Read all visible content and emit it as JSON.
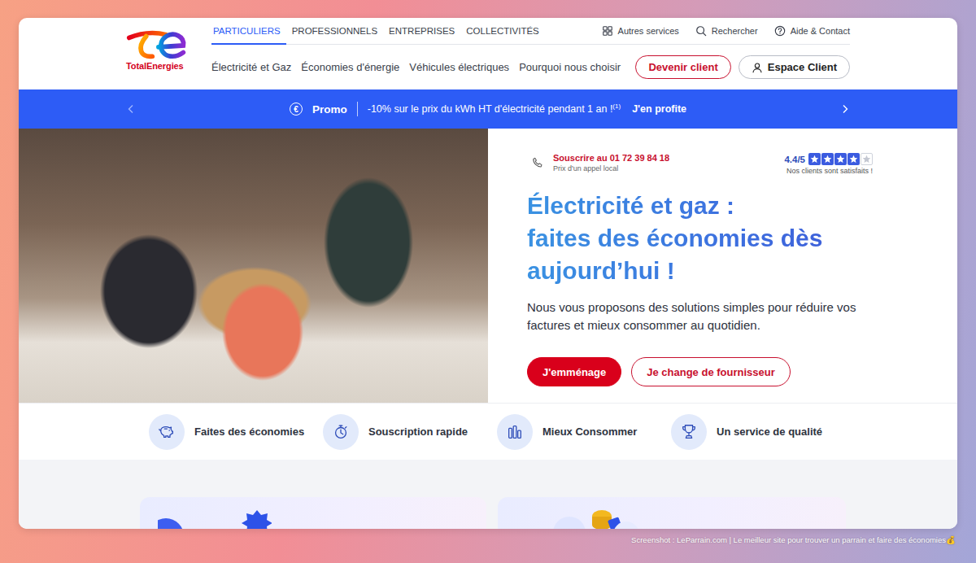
{
  "logo": {
    "text": "TotalEnergies"
  },
  "top_nav": [
    {
      "label": "PARTICULIERS",
      "selected": true
    },
    {
      "label": "PROFESSIONNELS",
      "selected": false
    },
    {
      "label": "ENTREPRISES",
      "selected": false
    },
    {
      "label": "COLLECTIVITÉS",
      "selected": false
    }
  ],
  "utility_links": [
    "Autres services",
    "Rechercher",
    "Aide & Contact"
  ],
  "main_nav": [
    "Électricité et Gaz",
    "Économies d'énergie",
    "Véhicules électriques",
    "Pourquoi nous choisir"
  ],
  "header_buttons": [
    "Devenir client",
    "Espace Client"
  ],
  "promo": {
    "icon": "€",
    "label": "Promo",
    "text": "-10% sur le prix du kWh HT d'électricité pendant 1 an !",
    "note": "(1)",
    "cta": "J'en profite"
  },
  "hero": {
    "phone": "Souscrire au 01 72 39 84 18",
    "phone_note": "Prix d'un appel local",
    "rating": "4.4/5",
    "stars": 4,
    "rating_note": "Nos clients sont satisfaits !",
    "title": [
      "Électricité et gaz :",
      "faites des économies dès",
      "aujourd’hui !"
    ],
    "text": "Nous vous proposons des solutions simples pour réduire vos factures et mieux consommer au quotidien.",
    "buttons": [
      "J'emménage",
      "Je change de fournisseur"
    ]
  },
  "features": [
    "Faites des économies",
    "Souscription rapide",
    "Mieux Consommer",
    "Un service de qualité"
  ],
  "caption": "Screenshot : LeParrain.com | Le meilleur site pour trouver un parrain et faire des économies💰"
}
